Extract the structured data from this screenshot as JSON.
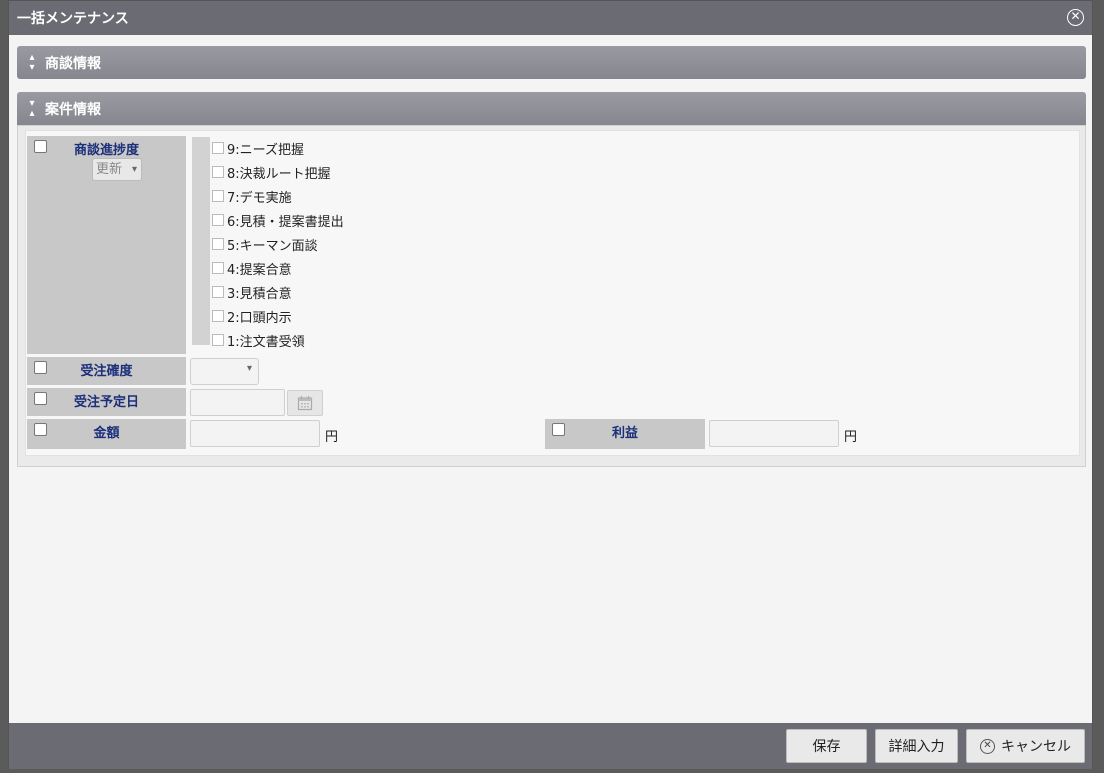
{
  "dialog": {
    "title": "一括メンテナンス"
  },
  "sections": {
    "negotiation": {
      "label": "商談情報"
    },
    "case": {
      "label": "案件情報"
    }
  },
  "fields": {
    "progress": {
      "label": "商談進捗度",
      "select_value": "更新"
    },
    "order_confidence": {
      "label": "受注確度",
      "select_value": ""
    },
    "order_date": {
      "label": "受注予定日",
      "value": ""
    },
    "amount": {
      "label": "金額",
      "value": "",
      "unit": "円"
    },
    "profit": {
      "label": "利益",
      "value": "",
      "unit": "円"
    }
  },
  "stages": [
    "9:ニーズ把握",
    "8:決裁ルート把握",
    "7:デモ実施",
    "6:見積・提案書提出",
    "5:キーマン面談",
    "4:提案合意",
    "3:見積合意",
    "2:口頭内示",
    "1:注文書受領"
  ],
  "footer": {
    "save_label": "保存",
    "detail_label": "詳細入力",
    "cancel_label": "キャンセル"
  },
  "colors": {
    "titlebar": "#6b6b73",
    "label_bg": "#c8c8c8",
    "label_text": "#1c2f7a"
  },
  "icons": {
    "close": "close-icon",
    "expand": "expand-icon",
    "collapse": "collapse-icon",
    "calendar": "calendar-icon",
    "cancel": "cancel-circle-icon"
  }
}
